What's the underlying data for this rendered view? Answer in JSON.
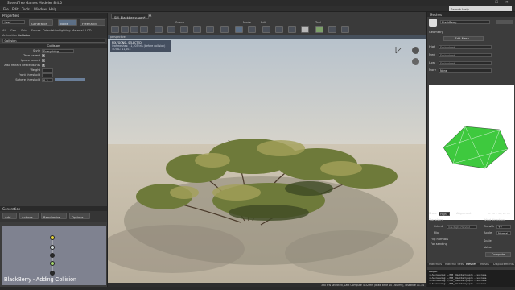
{
  "app": {
    "title": "SpeedTree Games Modeler 8.4.0",
    "window_controls": [
      "—",
      "☐",
      "✕"
    ]
  },
  "menu": [
    "File",
    "Edit",
    "Tools",
    "Window",
    "Help"
  ],
  "search": {
    "placeholder": "Search Help"
  },
  "properties": {
    "header": "Properties",
    "leaf_field": "Leaf",
    "generator_btn": "Generator",
    "node_btn": "Node",
    "freehand_btn": "Freehand",
    "tabs": [
      "All",
      "Gen",
      "Skin",
      "Forces",
      "Orientation",
      "Lighting",
      "Material",
      "LOD"
    ],
    "subtabs": [
      "Animation",
      "Collision"
    ],
    "collision_field": "Collision",
    "section_title": "Collision",
    "rows": [
      {
        "label": "Style",
        "value": "Everything"
      },
      {
        "label": "Take parent",
        "value": "☑"
      },
      {
        "label": "Ignore parent",
        "value": "☑"
      },
      {
        "label": "Also retract descendants",
        "value": "☑"
      },
      {
        "label": "Weight",
        "value": ""
      },
      {
        "label": "Front threshold",
        "value": ""
      },
      {
        "label": "Sphere threshold",
        "value": "0.3"
      }
    ]
  },
  "generation": {
    "header": "Generation",
    "buttons": [
      "Add",
      "Actions",
      "Randomize",
      "Options"
    ],
    "overlay": "BlackBerry - Adding Collision"
  },
  "viewport": {
    "doc_tab": "SM_Blackberry.spm*",
    "close": "✕",
    "groups": [
      "Scene",
      "Mode",
      "Edit",
      "Tool"
    ],
    "head": "perspective",
    "info_lines": [
      "POLYGONS - SELECTED",
      "leaf meshes: 11,203 tris (before collision)",
      "TOTAL: 11,203"
    ],
    "status": "330 tris selected, Last Compute 4.32 ms (draw time 107.60 ms), distance 11.34"
  },
  "meshes": {
    "header": "Meshes",
    "mesh_name": "BlackBerry",
    "geometry_label": "Geometry",
    "edit_mesh_btn": "Edit Mesh...",
    "lods": [
      {
        "label": "High",
        "value": "Embedded"
      },
      {
        "label": "Med",
        "value": "Embedded"
      },
      {
        "label": "Low",
        "value": "Embedded"
      }
    ],
    "more_label": "More",
    "more_value": "None",
    "show_label": "Show",
    "show_value": "High",
    "alignment_label": "Alignment",
    "coords": "X: 28 Y: 26, W: 36",
    "transform_label": "Transform",
    "orient_label": "Orient",
    "orient_value": "Use Right-Handed",
    "flip_label": "Flip",
    "wind_label": "Wind direction",
    "growth_label": "Growth",
    "growth_value": "+Y",
    "apple_label": "Apple",
    "apple_value": "Normal",
    "flip_normals_label": "Flip normals",
    "for_sending_label": "For sending",
    "scale_label": "Scale",
    "value_label": "Value",
    "compute_btn": "Compute",
    "bottom_tabs": [
      "Materials",
      "Material Sets",
      "Meshes",
      "Masks",
      "Displacements"
    ],
    "output_header": "Output",
    "output_lines": [
      "> Autosaving: ~/SM_Blackberry.spm ... success.",
      "> Autosaving: ~/SM_Blackberry.spm ... success.",
      "> Autosaving: ~/SM_Blackberry.spm ... success.",
      "> Autosaving: ~/SM_Blackberry.spm ... success."
    ]
  },
  "colors": {
    "accent": "#5c6f86",
    "sky_top": "#b9c4ce",
    "ground": "#c9bfae",
    "mesh_green": "#3ec93e"
  }
}
